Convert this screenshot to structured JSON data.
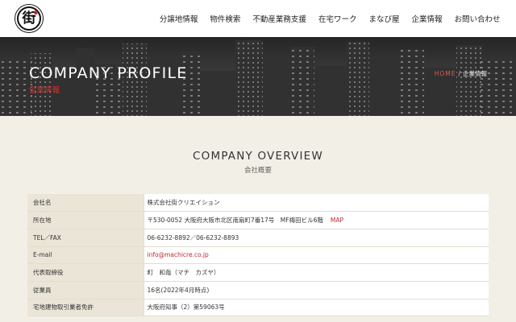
{
  "header": {
    "logo_glyph": "街",
    "nav": [
      "分譲地情報",
      "物件検索",
      "不動産業務支援",
      "在宅ワーク",
      "まなび屋",
      "企業情報",
      "お問い合わせ"
    ]
  },
  "hero": {
    "title": "COMPANY PROFILE",
    "subtitle": "企業情報",
    "breadcrumb": {
      "home": "HOME",
      "separator": "/",
      "current": "企業情報"
    }
  },
  "section": {
    "title": "COMPANY OVERVIEW",
    "subtitle": "会社概要"
  },
  "table": {
    "rows": [
      {
        "label": "会社名",
        "value": "株式会社街クリエイション"
      },
      {
        "label": "所在地",
        "value": "〒530-0052 大阪府大阪市北区南扇町7番17号　MF梅田ビル6階",
        "link": "MAP"
      },
      {
        "label": "TEL／FAX",
        "value": "06-6232-8892／06-6232-8893"
      },
      {
        "label": "E-mail",
        "value": "info@machicre.co.jp"
      },
      {
        "label": "代表取締役",
        "value": "町　和哉（マチ　カズヤ）"
      },
      {
        "label": "従業員",
        "value": "16名(2022年4月時点)"
      },
      {
        "label": "宅地建物取引業者免許",
        "value": "大阪府知事（2）第59063号"
      }
    ]
  },
  "colors": {
    "accent": "#c0282d",
    "background": "#f2efe6",
    "label_cell": "#ebe5d8"
  }
}
